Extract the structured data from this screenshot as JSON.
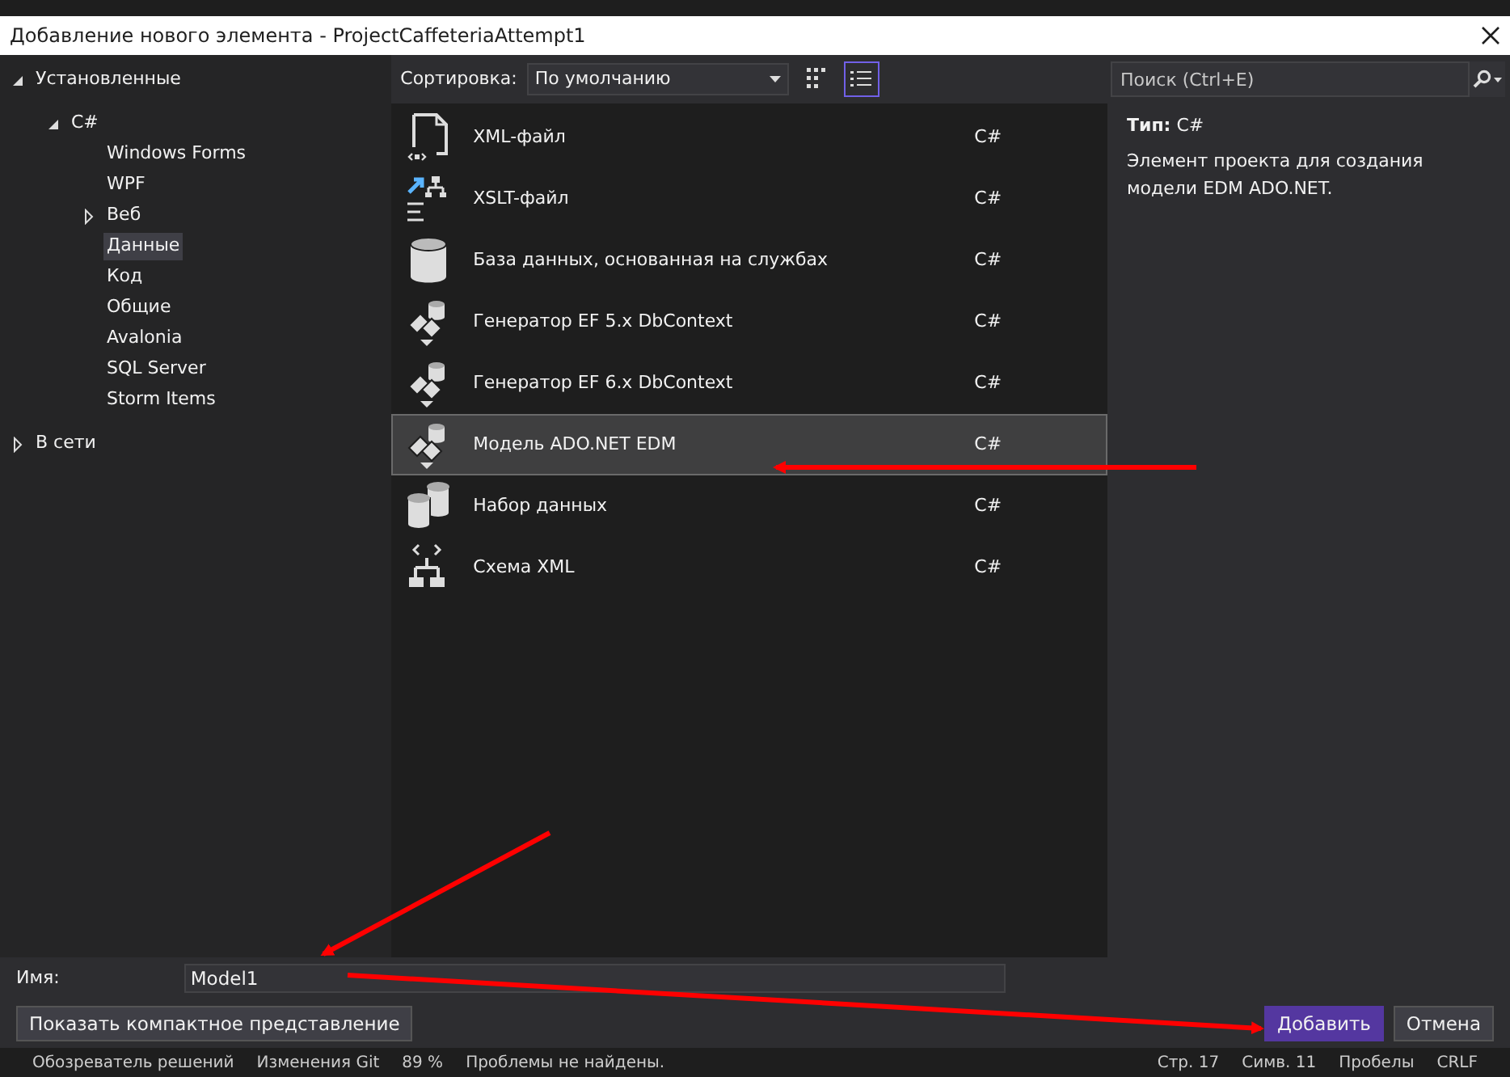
{
  "window": {
    "title": "Добавление нового элемента  - ProjectCaffeteriaAttempt1"
  },
  "tree": [
    {
      "label": "Установленные",
      "expanded": true,
      "selected": false,
      "children": [
        {
          "label": "C#",
          "expanded": true,
          "selected": false,
          "children": [
            {
              "label": "Windows Forms",
              "selected": false
            },
            {
              "label": "WPF",
              "selected": false
            },
            {
              "label": "Веб",
              "expanded": false,
              "selected": false
            },
            {
              "label": "Данные",
              "selected": true
            },
            {
              "label": "Код",
              "selected": false
            },
            {
              "label": "Общие",
              "selected": false
            },
            {
              "label": "Avalonia",
              "selected": false
            },
            {
              "label": "SQL Server",
              "selected": false
            },
            {
              "label": "Storm Items",
              "selected": false
            }
          ]
        }
      ]
    },
    {
      "label": "В сети",
      "expanded": false,
      "selected": false
    }
  ],
  "toolbar": {
    "sort_label": "Сортировка:",
    "sort_value": "По умолчанию",
    "views": [
      {
        "kind": "grid",
        "selected": false
      },
      {
        "kind": "list",
        "selected": true
      }
    ],
    "search": {
      "placeholder": "Поиск (Ctrl+E)"
    }
  },
  "templates": [
    {
      "kind": "xml",
      "name": "XML-файл",
      "language": "C#",
      "selected": false
    },
    {
      "kind": "xslt",
      "name": "XSLT-файл",
      "language": "C#",
      "selected": false
    },
    {
      "kind": "database",
      "name": "База данных, основанная на службах",
      "language": "C#",
      "selected": false
    },
    {
      "kind": "generator",
      "name": "Генератор EF 5.x DbContext",
      "language": "C#",
      "selected": false
    },
    {
      "kind": "generator",
      "name": "Генератор EF 6.x DbContext",
      "language": "C#",
      "selected": false
    },
    {
      "kind": "generator",
      "name": "Модель ADO.NET EDM",
      "language": "C#",
      "selected": true
    },
    {
      "kind": "dataset",
      "name": "Набор данных",
      "language": "C#",
      "selected": false
    },
    {
      "kind": "schema",
      "name": "Схема XML",
      "language": "C#",
      "selected": false
    }
  ],
  "details": {
    "type_label": "Тип:",
    "type_value": "C#",
    "description": "Элемент проекта для создания модели EDM ADO.NET."
  },
  "name_field": {
    "label": "Имя:",
    "value": "Model1"
  },
  "buttons": [
    {
      "kind": "secondary",
      "label": "Показать компактное представление"
    },
    {
      "kind": "primary",
      "label": "Добавить"
    },
    {
      "kind": "secondary",
      "label": "Отмена"
    }
  ],
  "status_bar": [
    "Обозреватель решений",
    "Изменения Git",
    "89 %",
    "Проблемы не найдены.",
    "Стр. 17",
    "Симв. 11",
    "Пробелы",
    "CRLF"
  ]
}
